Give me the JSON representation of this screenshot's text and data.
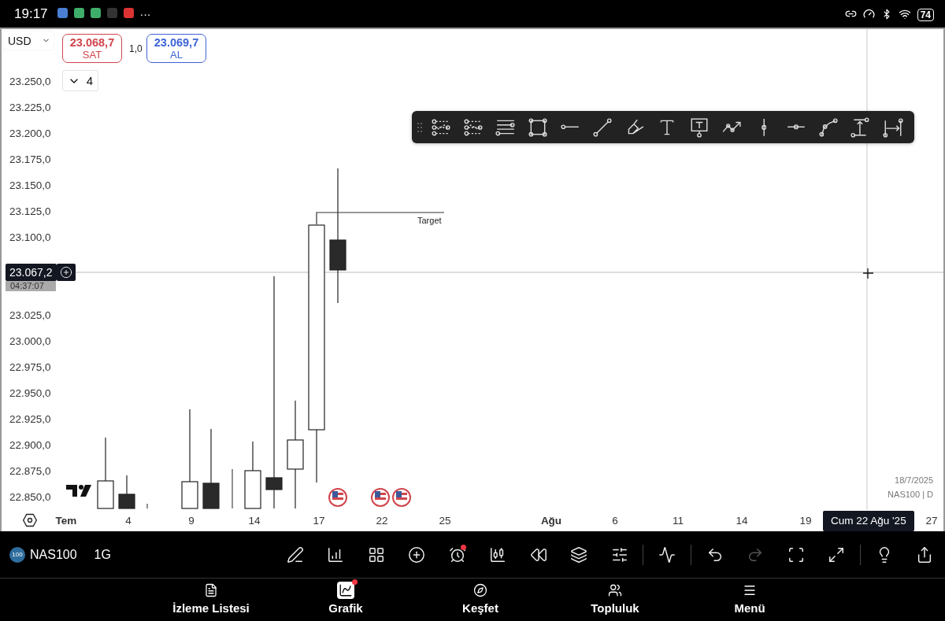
{
  "status_bar": {
    "time": "19:17",
    "more": "···",
    "battery": "74"
  },
  "chart": {
    "currency": "USD",
    "sell": {
      "price": "23.068,7",
      "label": "SAT"
    },
    "spread": "1,0",
    "buy": {
      "price": "23.069,7",
      "label": "AL"
    },
    "quantity": "4",
    "price_axis": [
      "23.250,0",
      "23.225,0",
      "23.200,0",
      "23.175,0",
      "23.150,0",
      "23.125,0",
      "23.100,0",
      "23.025,0",
      "23.000,0",
      "22.975,0",
      "22.950,0",
      "22.925,0",
      "22.900,0",
      "22.875,0",
      "22.850,0"
    ],
    "crosshair_price": "23.067,2",
    "countdown": "04:37:07",
    "annotation": "Target",
    "date_axis": [
      {
        "label": "Tem",
        "kind": "month"
      },
      {
        "label": "4",
        "kind": "day"
      },
      {
        "label": "9",
        "kind": "day"
      },
      {
        "label": "14",
        "kind": "day"
      },
      {
        "label": "17",
        "kind": "day"
      },
      {
        "label": "22",
        "kind": "day"
      },
      {
        "label": "25",
        "kind": "day"
      },
      {
        "label": "Ağu",
        "kind": "month"
      },
      {
        "label": "6",
        "kind": "day"
      },
      {
        "label": "11",
        "kind": "day"
      },
      {
        "label": "14",
        "kind": "day"
      },
      {
        "label": "19",
        "kind": "day"
      },
      {
        "label": "27",
        "kind": "day"
      }
    ],
    "crosshair_date": "Cum 22 Ağu '25",
    "info": [
      "18/7/2025",
      "NAS100 | D"
    ]
  },
  "watchlist": {
    "badge": "100",
    "symbol": "NAS100",
    "interval": "1G"
  },
  "toolbar": {
    "alarm": {
      "alert": true
    },
    "redo": {
      "disabled": true
    }
  },
  "nav": [
    {
      "label": "İzleme Listesi",
      "selected": false,
      "alert": false
    },
    {
      "label": "Grafik",
      "selected": true,
      "alert": true
    },
    {
      "label": "Keşfet",
      "selected": false,
      "alert": false
    },
    {
      "label": "Topluluk",
      "selected": false,
      "alert": false
    },
    {
      "label": "Menü",
      "selected": false,
      "alert": false
    }
  ]
}
